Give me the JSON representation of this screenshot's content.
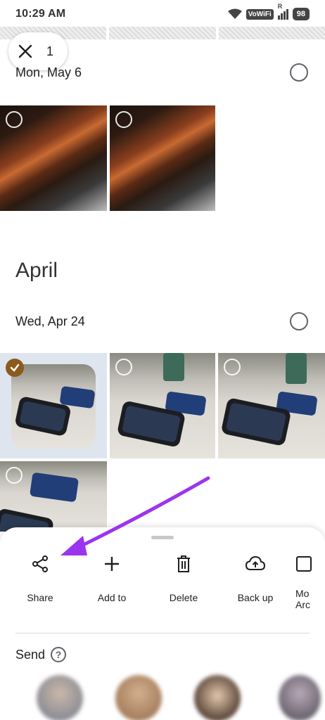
{
  "status_bar": {
    "time": "10:29 AM",
    "network": "VoWiFi",
    "roaming": "R",
    "battery": "98"
  },
  "selection": {
    "count": "1"
  },
  "groups": [
    {
      "date": "Mon, May 6"
    },
    {
      "date": "Wed, Apr 24"
    }
  ],
  "month_heading": "April",
  "bottom_sheet": {
    "actions": [
      {
        "label": "Share",
        "icon": "share-icon"
      },
      {
        "label": "Add to",
        "icon": "plus-icon"
      },
      {
        "label": "Delete",
        "icon": "trash-icon"
      },
      {
        "label": "Back up",
        "icon": "cloud-upload-icon"
      },
      {
        "label": "Mo\nArc",
        "icon": "archive-icon"
      }
    ],
    "send_label": "Send"
  },
  "colors": {
    "accent_arrow": "#9b34ef",
    "selected_check": "#8a5a1e"
  }
}
